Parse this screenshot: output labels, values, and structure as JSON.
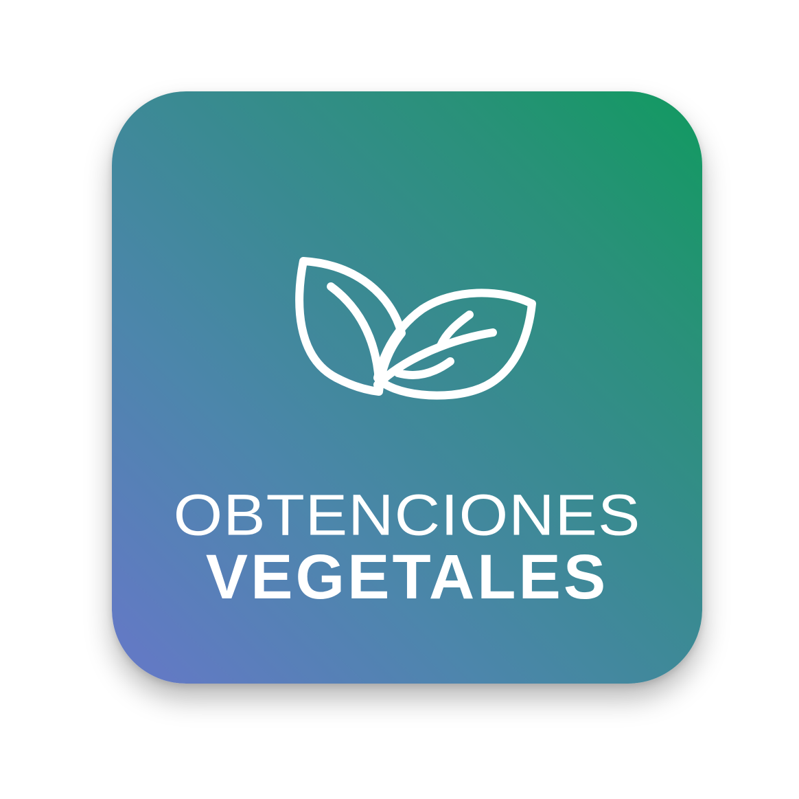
{
  "card": {
    "icon": "leaves-icon",
    "title_light": "OBTENCIONES",
    "title_bold": "VEGETALES"
  },
  "colors": {
    "gradient_start": "#6678c8",
    "gradient_end": "#119a60",
    "text": "#ffffff"
  }
}
